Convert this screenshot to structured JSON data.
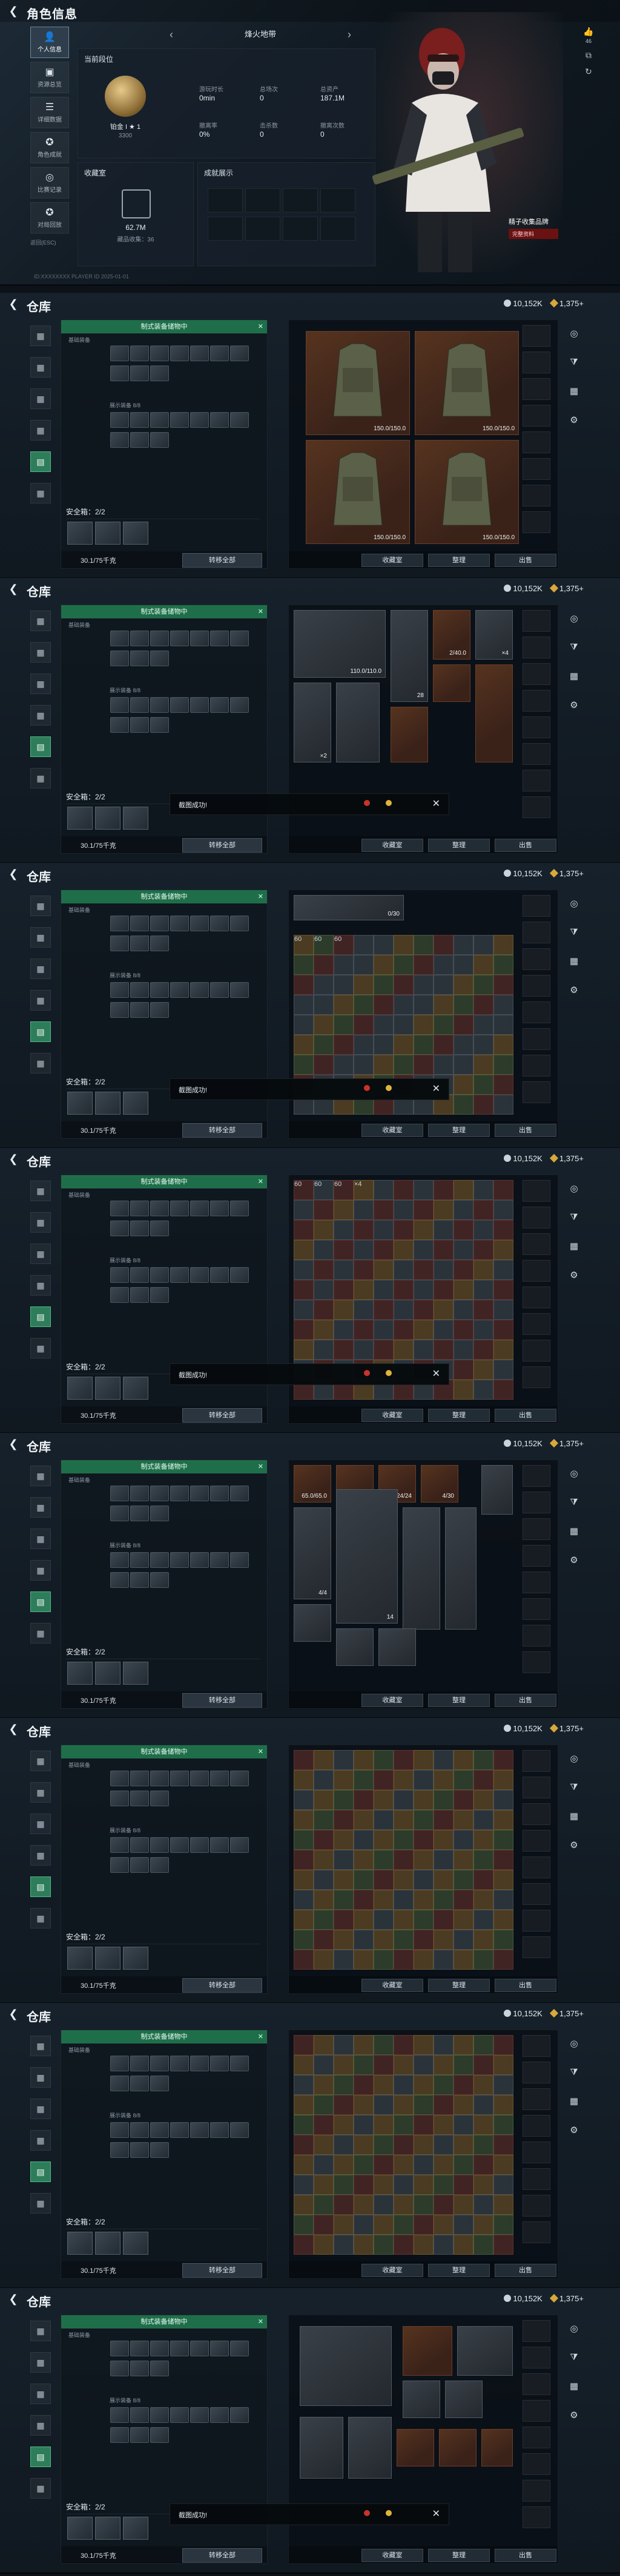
{
  "profile": {
    "title": "角色信息",
    "nav": [
      {
        "label": "个人信息",
        "icon": "person-icon"
      },
      {
        "label": "资源总览",
        "icon": "bag-icon"
      },
      {
        "label": "详细数据",
        "icon": "list-icon"
      },
      {
        "label": "角色成就",
        "icon": "trophy-icon"
      },
      {
        "label": "比赛记录",
        "icon": "target-icon"
      },
      {
        "label": "对局回放",
        "icon": "trophy-icon"
      }
    ],
    "nav_footer": "返回(ESC)",
    "season": "烽火地带",
    "season_card": {
      "title": "当前段位",
      "medal_caption": "铂金 I ★ 1",
      "score": "3300",
      "stats": [
        {
          "label": "游玩时长",
          "value": "0min"
        },
        {
          "label": "总场次",
          "value": "0"
        },
        {
          "label": "总资产",
          "value": "187.1M"
        },
        {
          "label": "撤离率",
          "value": "0%"
        },
        {
          "label": "击杀数",
          "value": "0"
        },
        {
          "label": "撤离次数",
          "value": "0"
        }
      ]
    },
    "collection": {
      "title": "收藏室",
      "value": "62.7M",
      "caption": "藏品收集：36"
    },
    "achievement_title": "成就展示",
    "player_name": "精子收集品牌",
    "player_sub": "完整资料",
    "likes": "46",
    "path_text": "ID:XXXXXXXX  PLAYER ID  2025-01-01"
  },
  "warehouse": {
    "title": "仓库",
    "currency_coin": "10,152K",
    "currency_gem": "1,375",
    "currency_plus": "+",
    "craft_bar": "制式装备储物中",
    "sub_caption": "基础装备",
    "cap_caption": "展示装备 8/8",
    "safe_label": "安全箱：2/2",
    "capacity": "30.1/75千克",
    "transfer": "转移全部",
    "btn_collect": "收藏室",
    "btn_sort": "整理",
    "btn_sell": "出售",
    "toast": "截图成功!"
  },
  "sections": [
    {
      "id": "armor",
      "toast": false,
      "labels": [
        "150.0/150.0",
        "150.0/150.0",
        "150.0/150.0",
        "150.0/150.0"
      ]
    },
    {
      "id": "mixed",
      "toast": true,
      "labels": [
        "110.0/110.0",
        "28",
        "2/40.0",
        "×4",
        "×2"
      ]
    },
    {
      "id": "ammo",
      "toast": true,
      "labels": [
        "0/30",
        "60",
        "60",
        "60"
      ]
    },
    {
      "id": "consumables",
      "toast": true,
      "labels": [
        "60",
        "60",
        "60",
        "60",
        "×4",
        "×4"
      ]
    },
    {
      "id": "gear",
      "toast": false,
      "labels": [
        "65.0/65.0",
        "12.0/12.0",
        "24/24",
        "4/30",
        "4/4",
        "14"
      ]
    },
    {
      "id": "loot1",
      "toast": false,
      "labels": []
    },
    {
      "id": "loot2",
      "toast": false,
      "labels": []
    },
    {
      "id": "bigloot",
      "toast": true,
      "labels": []
    }
  ]
}
